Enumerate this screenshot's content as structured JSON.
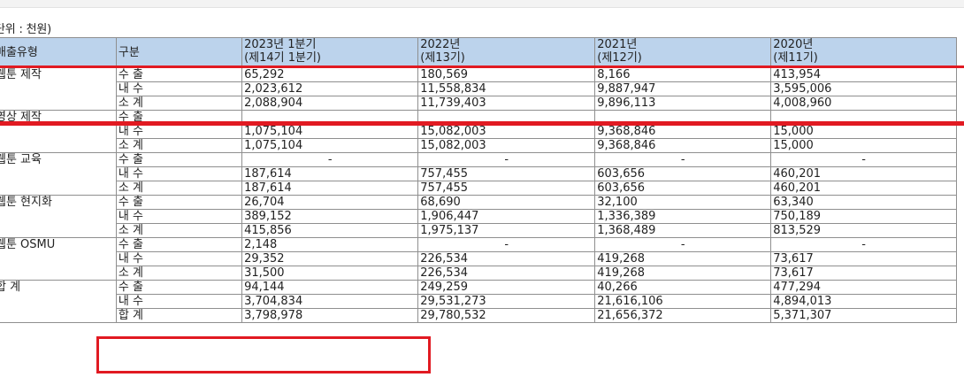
{
  "unit_label": "단위 : 천원)",
  "columns": {
    "type": "매출유형",
    "division": "구분",
    "periods": [
      {
        "year": "2023년 1분기",
        "term": "(제14기 1분기)"
      },
      {
        "year": "2022년",
        "term": "(제13기)"
      },
      {
        "year": "2021년",
        "term": "(제12기)"
      },
      {
        "year": "2020년",
        "term": "(제11기)"
      }
    ]
  },
  "groups": [
    {
      "name": "웹툰 제작",
      "rows": [
        {
          "label": "수 출",
          "values": [
            "65,292",
            "180,569",
            "8,166",
            "413,954"
          ]
        },
        {
          "label": "내 수",
          "values": [
            "2,023,612",
            "11,558,834",
            "9,887,947",
            "3,595,006"
          ]
        },
        {
          "label": "소 계",
          "values": [
            "2,088,904",
            "11,739,403",
            "9,896,113",
            "4,008,960"
          ]
        }
      ]
    },
    {
      "name": "영상 제작",
      "rows": [
        {
          "label": "수 출",
          "values": [
            "",
            "",
            "",
            ""
          ]
        },
        {
          "label": "내 수",
          "values": [
            "1,075,104",
            "15,082,003",
            "9,368,846",
            "15,000"
          ]
        },
        {
          "label": "소 계",
          "values": [
            "1,075,104",
            "15,082,003",
            "9,368,846",
            "15,000"
          ]
        }
      ]
    },
    {
      "name": "웹툰 교육",
      "rows": [
        {
          "label": "수 출",
          "values": [
            "-",
            "-",
            "-",
            "-"
          ],
          "center": true
        },
        {
          "label": "내 수",
          "values": [
            "187,614",
            "757,455",
            "603,656",
            "460,201"
          ]
        },
        {
          "label": "소 계",
          "values": [
            "187,614",
            "757,455",
            "603,656",
            "460,201"
          ]
        }
      ]
    },
    {
      "name": "웹툰 현지화",
      "rows": [
        {
          "label": "수 출",
          "values": [
            "26,704",
            "68,690",
            "32,100",
            "63,340"
          ]
        },
        {
          "label": "내 수",
          "values": [
            "389,152",
            "1,906,447",
            "1,336,389",
            "750,189"
          ]
        },
        {
          "label": "소 계",
          "values": [
            "415,856",
            "1,975,137",
            "1,368,489",
            "813,529"
          ]
        }
      ]
    },
    {
      "name": "웹툰 OSMU",
      "rows": [
        {
          "label": "수 출",
          "values": [
            "2,148",
            "-",
            "-",
            "-"
          ],
          "center_from": 1
        },
        {
          "label": "내 수",
          "values": [
            "29,352",
            "226,534",
            "419,268",
            "73,617"
          ]
        },
        {
          "label": "소 계",
          "values": [
            "31,500",
            "226,534",
            "419,268",
            "73,617"
          ]
        }
      ]
    },
    {
      "name": "합 계",
      "rows": [
        {
          "label": "수 출",
          "values": [
            "94,144",
            "249,259",
            "40,266",
            "477,294"
          ]
        },
        {
          "label": "내 수",
          "values": [
            "3,704,834",
            "29,531,273",
            "21,616,106",
            "4,894,013"
          ]
        },
        {
          "label": "합 계",
          "values": [
            "3,798,978",
            "29,780,532",
            "21,656,372",
            "5,371,307"
          ]
        }
      ]
    }
  ],
  "annotation_color": "#e11a22"
}
